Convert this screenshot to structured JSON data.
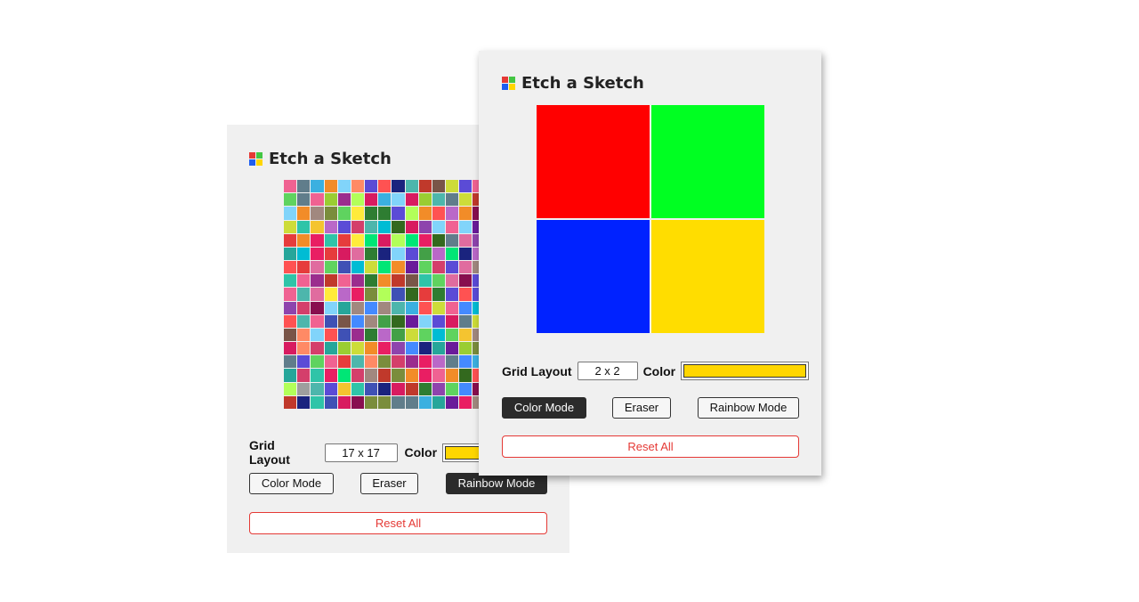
{
  "colors": {
    "logo": [
      "#e53935",
      "#43c643",
      "#1e5ef0",
      "#ffd600"
    ],
    "picker": "#ffd600",
    "reset": "#e53935"
  },
  "back_panel": {
    "title": "Etch a Sketch",
    "grid_label": "Grid Layout",
    "grid_value": "17 x 17",
    "color_label": "Color",
    "buttons": {
      "color_mode": "Color Mode",
      "eraser": "Eraser",
      "rainbow_mode": "Rainbow Mode"
    },
    "active_mode": "rainbow_mode",
    "reset": "Reset All",
    "grid_size": 17,
    "palette": [
      "#e06c9f",
      "#d43f6b",
      "#9b2d8e",
      "#5b4bd6",
      "#3bb0e0",
      "#2fc4a8",
      "#5fd35f",
      "#9acd32",
      "#f4c430",
      "#f28c28",
      "#e63c3c",
      "#c0392b",
      "#8e44ad",
      "#7a8d3c",
      "#2e7d32",
      "#26a69a",
      "#4db6ac",
      "#81d4fa",
      "#ba68c8",
      "#f06292",
      "#ff8a65",
      "#a1887f",
      "#607d8b",
      "#1a237e",
      "#880e4f",
      "#33691e",
      "#cddc39",
      "#00bcd4",
      "#3f51b5",
      "#e91e63",
      "#ffeb3b",
      "#795548",
      "#9e9e9e",
      "#6a1b9a",
      "#00e676",
      "#ff5252",
      "#448aff",
      "#b2ff59",
      "#d81b60",
      "#43a047"
    ]
  },
  "front_panel": {
    "title": "Etch a Sketch",
    "grid_label": "Grid Layout",
    "grid_value": "2 x 2",
    "color_label": "Color",
    "buttons": {
      "color_mode": "Color Mode",
      "eraser": "Eraser",
      "rainbow_mode": "Rainbow Mode"
    },
    "active_mode": "color_mode",
    "reset": "Reset All",
    "grid_size": 2,
    "cells": [
      "#ff0000",
      "#00ff22",
      "#0022ff",
      "#ffdd00"
    ]
  }
}
